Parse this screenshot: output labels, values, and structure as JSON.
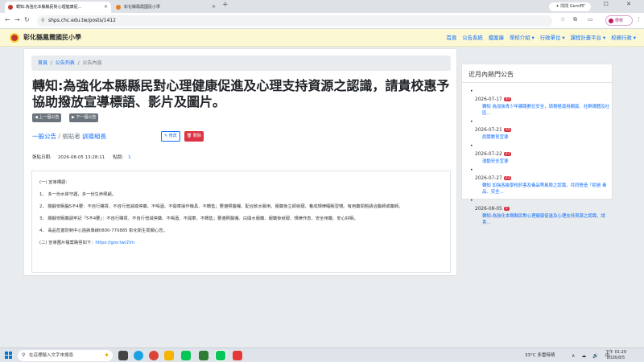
{
  "browser": {
    "tabs": [
      {
        "title": "轉知:為強化本縣縣民對心理健康促...",
        "favicon_color": "#c0392b",
        "active": true
      },
      {
        "title": "彰化縣鳳霞國民小學",
        "favicon_color": "#e67e22",
        "active": false
      }
    ],
    "new_tab_label": "+",
    "gemini_label": "✦ 問問 Gemini",
    "window_controls": "—  ☐  ✕",
    "url": "shps.chc.edu.tw/posts/1412",
    "profile_label": "學校"
  },
  "site": {
    "title": "彰化縣鳳霞國民小學",
    "nav": [
      "首頁",
      "公告系統",
      "檔案庫",
      "學校介紹 ▾",
      "行政單位 ▾",
      "課程計畫平台 ▾",
      "校務行政 ▾"
    ]
  },
  "breadcrumb": {
    "home": "首頁",
    "list": "公告列表",
    "current": "公告內容",
    "sep": "/"
  },
  "post": {
    "title": "轉知:為強化本縣縣民對心理健康促進及心理支持資源之認識，請貴校惠予協助撥放宣導標語、影片及圖片。",
    "prev_label": "◀ 上一個公告",
    "next_label": "▶ 下一個公告",
    "category": "一般公告",
    "poster_label": " / 張貼者 ",
    "poster": "訓導組長",
    "edit_label": "✎ 修改",
    "delete_label": "🗑 刪除",
    "date_label": "張貼日期:",
    "date_value": "2026-08-05 13:28:11",
    "hits_label": "點閱:",
    "hits_value": "1",
    "content": [
      "(一) 宣導標語：",
      "1、 多一份水岸守護，多一份生命照顧。",
      "2、 關靜安眠腦5不4要：不自行購買、不自行增減或停藥、不喝酒、不開車操作機具、不轉售；要遵照醫囑、配合飲水服用、服藥後立即就寢、養成規律睡眠習慣。有用藥問題請洽醫師或藥師。",
      "3、 關靜安眠藥請牢記「5不4要」：不自行購買、不自行增減停藥、不喝酒、不開車、不轉售；要遵照醫囑、白開水服藥、服藥後就寢、規律作息、安全用藥、安心好眠。",
      "4、 毒品危害防制中心諮詢專線0800-770885 彰化衛生局關心您。"
    ],
    "image_line_label": "(二) 宣導圖片檔案路徑如下：",
    "image_line_link": "https://gov.tw/2Vn"
  },
  "sidebar": {
    "title": "近月內熱門公告",
    "items": [
      {
        "date": "2026-07-17",
        "badge": "37",
        "title": "轉知 為加強青少年網路數位安全，請積極運用網頁、社群媒體及社區..."
      },
      {
        "date": "2026-07-21",
        "badge": "35",
        "title": "肩膀教育宣導"
      },
      {
        "date": "2026-07-22",
        "badge": "27",
        "title": "運動安全宣導"
      },
      {
        "date": "2026-07-27",
        "badge": "23",
        "title": "轉知 加強各級學校菸害及毒品等風險之認識，共同營造「拒絕 毒品、安全..."
      },
      {
        "date": "2026-08-05",
        "badge": "1",
        "title": "轉知:為強化本縣縣民對心理健康促進及心理支持資源之認識，請貴..."
      }
    ]
  },
  "taskbar": {
    "search_placeholder": "在這裡輸入文字來搜尋",
    "weather": "33°C  多雲時晴",
    "tray": "∧ ☁ 🔊 中",
    "time": "下午 01:29",
    "date": "2026/8/5"
  },
  "colors": {
    "navbar_bg": "#fcf8d4",
    "link": "#0d6efd",
    "danger": "#dc3545",
    "secondary": "#6c757d"
  }
}
